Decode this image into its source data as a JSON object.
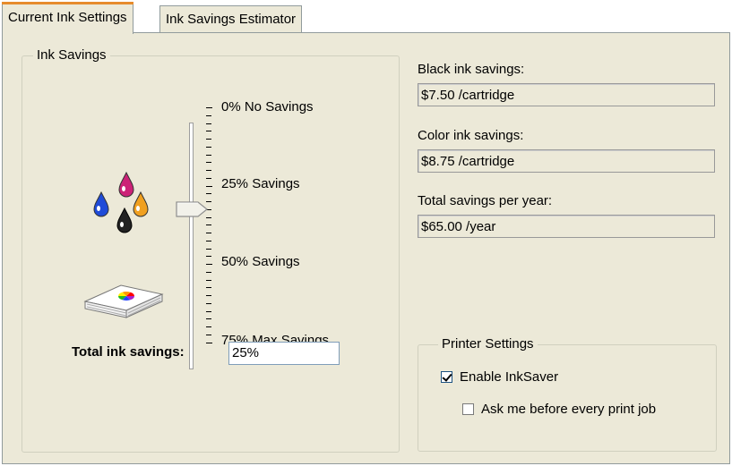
{
  "tabs": [
    {
      "label": "Current Ink Settings",
      "active": true
    },
    {
      "label": "Ink Savings Estimator",
      "active": false
    }
  ],
  "ink_savings_group": {
    "title": "Ink Savings",
    "slider": {
      "levels": [
        "0% No Savings",
        "25% Savings",
        "50% Savings",
        "75% Max Savings"
      ],
      "selected": "25% Savings",
      "value_percent": 25
    },
    "total_label": "Total ink savings:",
    "total_value": "25%",
    "icons": [
      "magenta-ink-drop-icon",
      "blue-ink-drop-icon",
      "yellow-ink-drop-icon",
      "black-ink-drop-icon",
      "paper-stack-icon"
    ]
  },
  "savings": {
    "black_label": "Black ink savings:",
    "black_value": "$7.50 /cartridge",
    "color_label": "Color ink savings:",
    "color_value": "$8.75 /cartridge",
    "total_label": "Total savings per year:",
    "total_value": "$65.00 /year"
  },
  "printer_settings": {
    "title": "Printer Settings",
    "enable_inksaver": {
      "label": "Enable InkSaver",
      "checked": true
    },
    "ask_before_print": {
      "label": "Ask me before every print job",
      "checked": false
    }
  },
  "colors": {
    "panel_bg": "#ece9d8",
    "tab_highlight": "#e68b2c",
    "magenta": "#cc2277",
    "cyan": "#1f4bd8",
    "yellow": "#f0a020",
    "black": "#222222"
  }
}
